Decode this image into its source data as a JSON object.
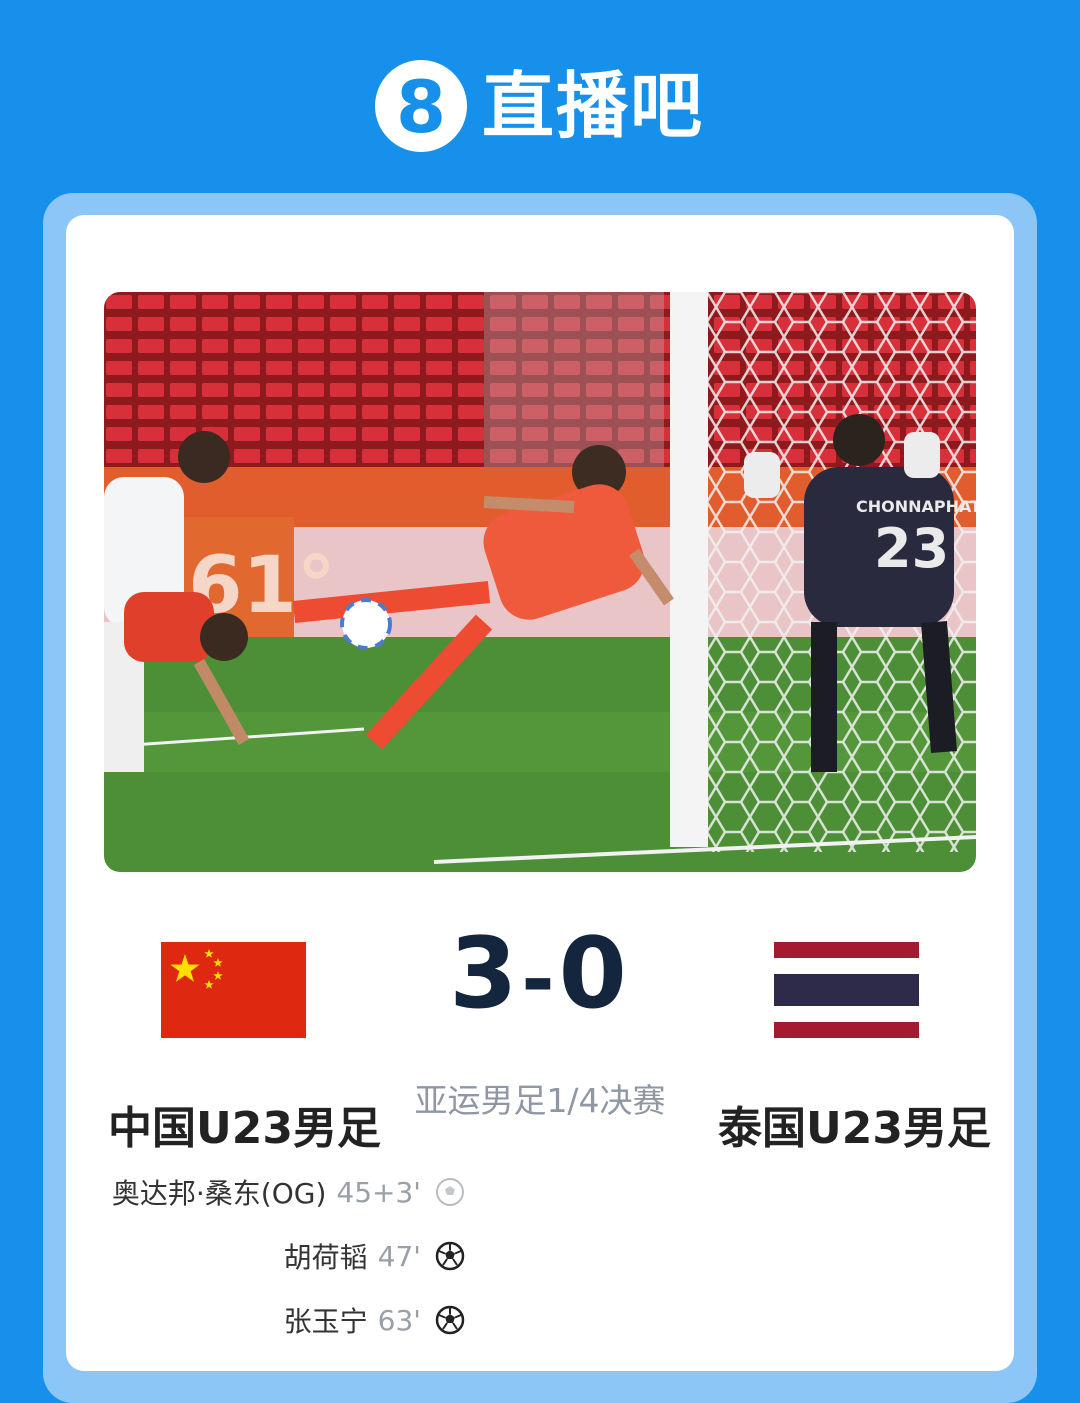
{
  "brand": {
    "logo_digit": "8",
    "name": "直播吧",
    "color": "#1690ea"
  },
  "match": {
    "home_team": "中国U23男足",
    "away_team": "泰国U23男足",
    "home_score": "3",
    "away_score": "0",
    "separator": "-",
    "stage": "亚运男足1/4决赛",
    "photo": {
      "jersey_text": "CHONNAPHAT",
      "jersey_number": "23",
      "board_text": "361°"
    }
  },
  "goals": [
    {
      "scorer": "奥达邦·桑东(OG)",
      "minute": "45+3'",
      "icon": "own-goal-ball-icon"
    },
    {
      "scorer": "胡荷韬",
      "minute": "47'",
      "icon": "soccer-ball-icon"
    },
    {
      "scorer": "张玉宁",
      "minute": "63'",
      "icon": "soccer-ball-icon"
    }
  ],
  "colors": {
    "score": "#14263e",
    "china_red": "#de2910",
    "china_yellow": "#ffde00",
    "thai_red": "#a51931",
    "thai_blue": "#2d2a4a"
  }
}
